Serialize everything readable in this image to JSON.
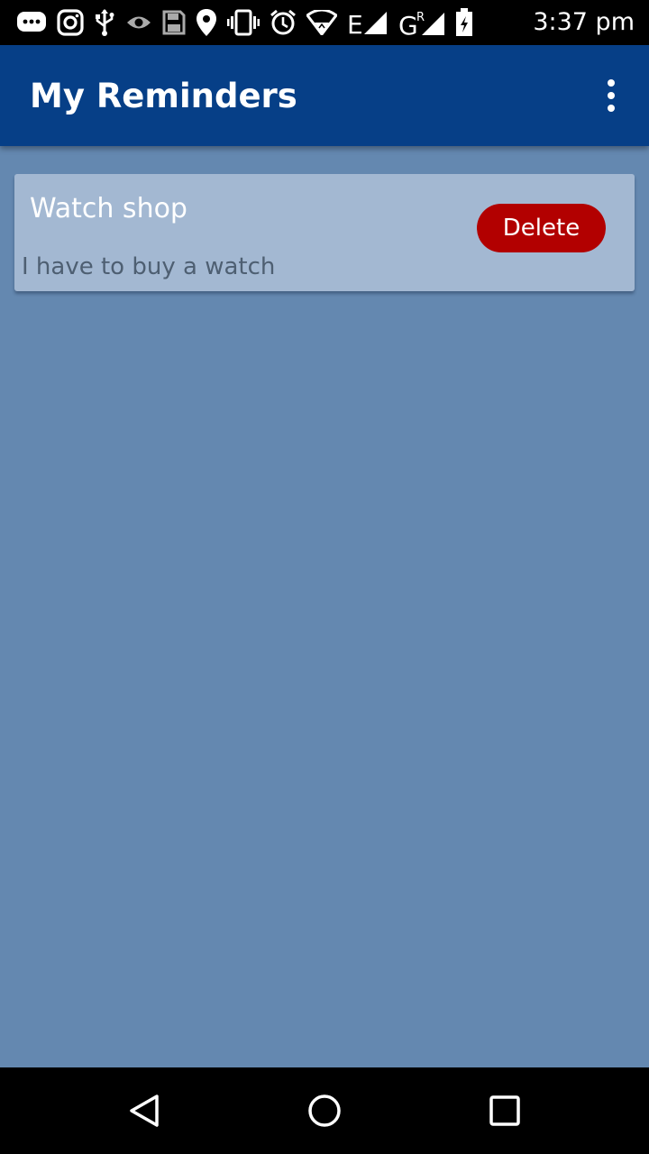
{
  "status_bar": {
    "time": "3:37 pm",
    "icons": [
      "messenger-icon",
      "instagram-icon",
      "usb-icon",
      "eye-icon",
      "save-icon",
      "location-icon",
      "vibrate-icon",
      "alarm-icon",
      "wifi-icon",
      "signal-e-icon",
      "signal-g-icon",
      "battery-icon"
    ]
  },
  "app_bar": {
    "title": "My Reminders",
    "menu_icon": "more-vert-icon"
  },
  "reminders": [
    {
      "title": "Watch shop",
      "description": "I have to buy a watch",
      "delete_label": "Delete"
    }
  ],
  "nav_bar": {
    "icons": [
      "back-icon",
      "home-icon",
      "recents-icon"
    ]
  },
  "colors": {
    "background": "#6488b0",
    "app_bar": "#063f87",
    "card": "#a3b8d2",
    "delete_button": "#b20000"
  }
}
